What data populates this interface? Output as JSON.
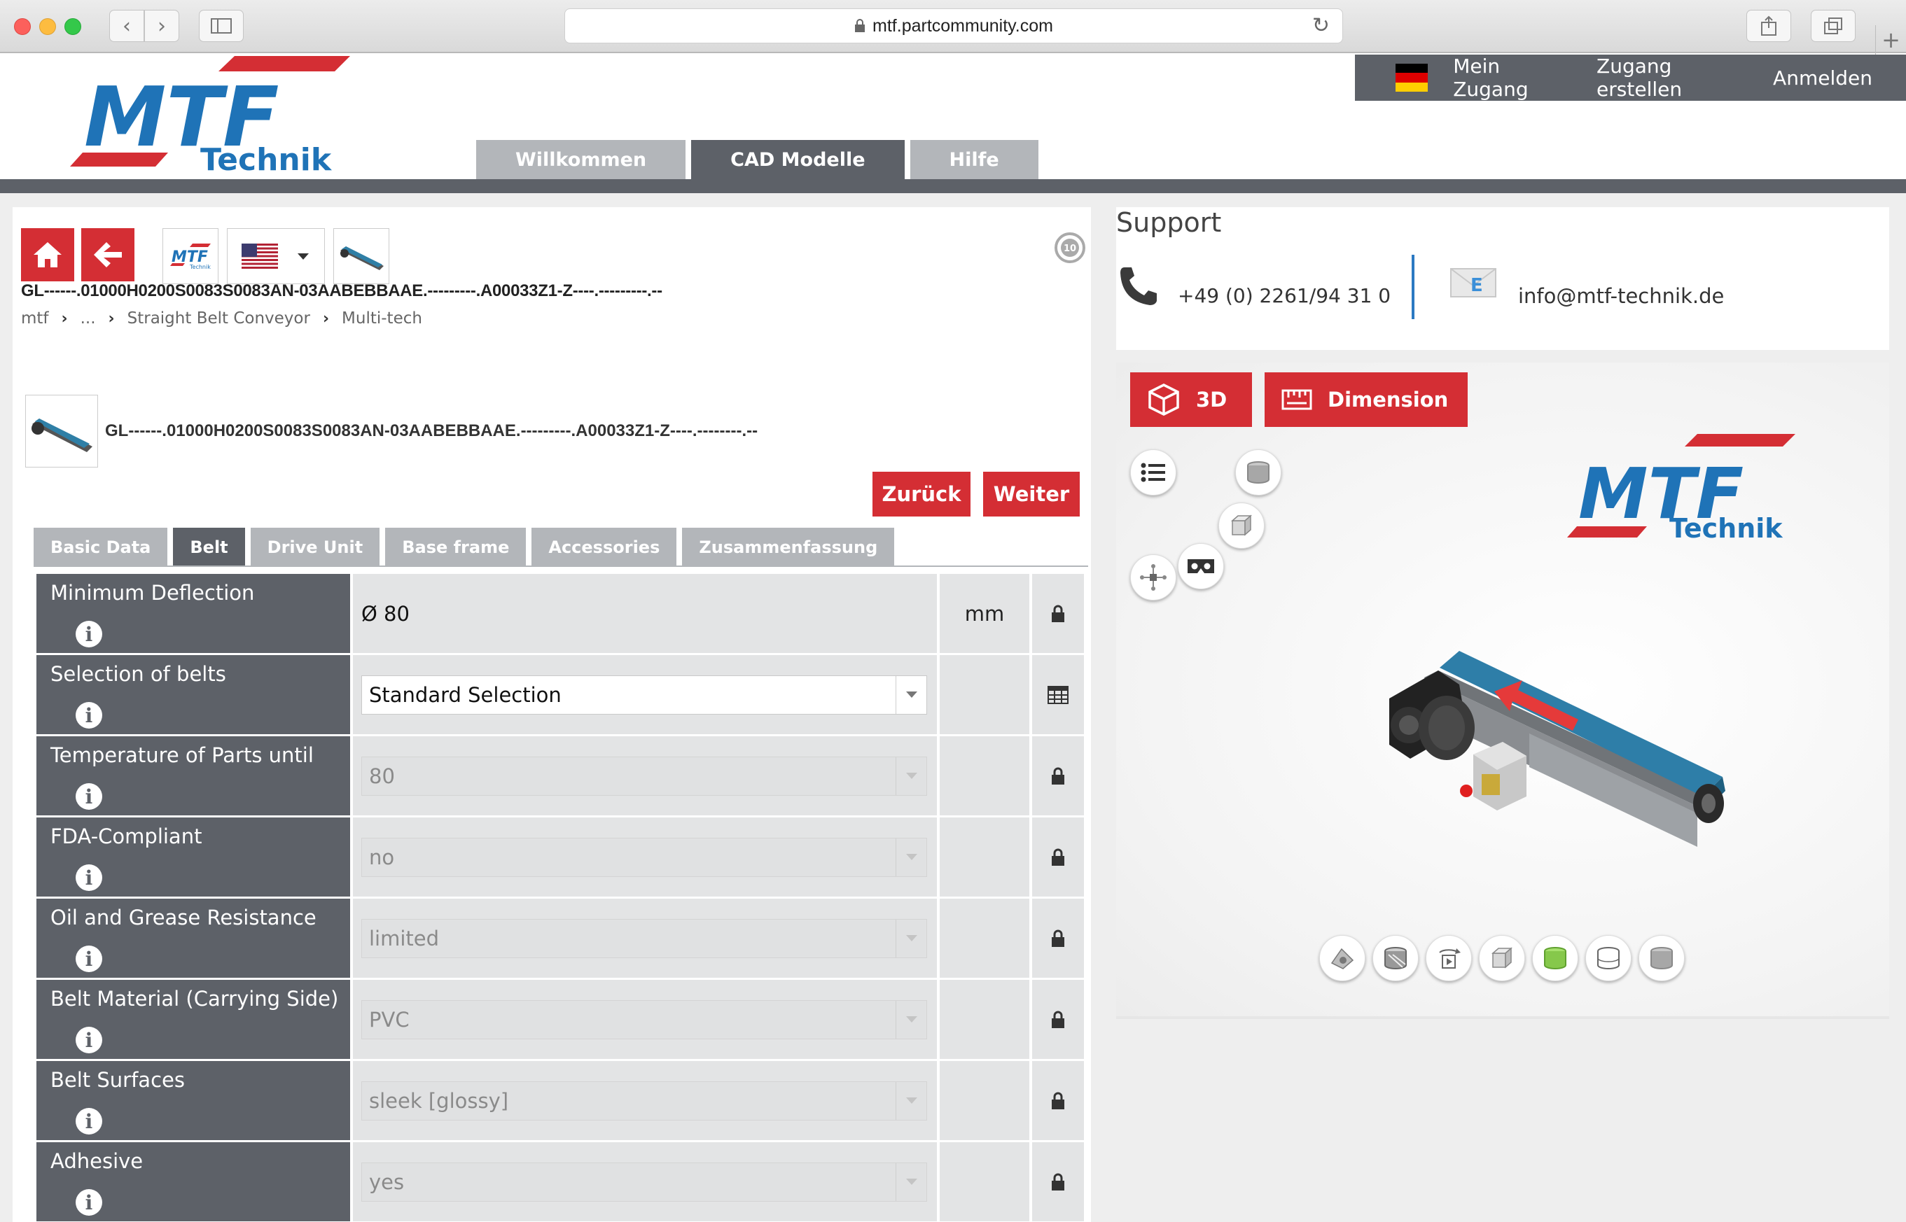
{
  "browser": {
    "url": "mtf.partcommunity.com"
  },
  "header": {
    "logo_brand": "MTF",
    "logo_sub": "Technik",
    "user_links": [
      "Mein Zugang",
      "Zugang erstellen",
      "Anmelden"
    ],
    "tabs": [
      {
        "label": "Willkommen",
        "active": false
      },
      {
        "label": "CAD Modelle",
        "active": true
      },
      {
        "label": "Hilfe",
        "active": false
      }
    ]
  },
  "part": {
    "title_code": "GL------.01000H0200S0083S0083AN-03AABEBBAAE.---------.A00033Z1-Z----.---------.--",
    "breadcrumb": [
      "mtf",
      "...",
      "Straight Belt Conveyor",
      "Multi-tech"
    ],
    "product_code": "GL------.01000H0200S0083S0083AN-03AABEBBAAE.---------.A00033Z1-Z----.--------.--",
    "back_label": "Zurück",
    "next_label": "Weiter",
    "rotation_badge": "10"
  },
  "subtabs": [
    {
      "label": "Basic Data",
      "active": false
    },
    {
      "label": "Belt",
      "active": true
    },
    {
      "label": "Drive Unit",
      "active": false
    },
    {
      "label": "Base frame",
      "active": false
    },
    {
      "label": "Accessories",
      "active": false
    },
    {
      "label": "Zusammenfassung",
      "active": false
    }
  ],
  "params": [
    {
      "name": "Minimum Deflection",
      "value": "Ø 80",
      "unit": "mm",
      "kind": "static",
      "action_icon": "lock-icon"
    },
    {
      "name": "Selection of belts",
      "value": "Standard Selection",
      "unit": "",
      "kind": "select",
      "action_icon": "table-icon"
    },
    {
      "name": "Temperature of Parts until",
      "value": "80",
      "unit": "",
      "kind": "disabled",
      "action_icon": "lock-icon"
    },
    {
      "name": "FDA-Compliant",
      "value": "no",
      "unit": "",
      "kind": "disabled",
      "action_icon": "lock-icon"
    },
    {
      "name": "Oil and Grease Resistance",
      "value": "limited",
      "unit": "",
      "kind": "disabled",
      "action_icon": "lock-icon"
    },
    {
      "name": "Belt Material (Carrying Side)",
      "value": "PVC",
      "unit": "",
      "kind": "disabled",
      "action_icon": "lock-icon"
    },
    {
      "name": "Belt Surfaces",
      "value": "sleek [glossy]",
      "unit": "",
      "kind": "disabled",
      "action_icon": "lock-icon"
    },
    {
      "name": "Adhesive",
      "value": "yes",
      "unit": "",
      "kind": "disabled",
      "action_icon": "lock-icon"
    }
  ],
  "support": {
    "title": "Support",
    "phone": "+49 (0) 2261/94 31 0",
    "email": "info@mtf-technik.de"
  },
  "viewer": {
    "btn_3d": "3D",
    "btn_dimension": "Dimension"
  },
  "colors": {
    "accent_red": "#d42e34",
    "dark_gray": "#5d6168",
    "tab_gray": "#b3b6ba",
    "brand_blue": "#1f73b7"
  }
}
